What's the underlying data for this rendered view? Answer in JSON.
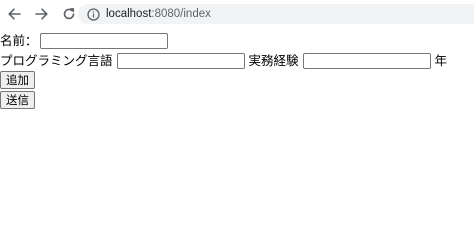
{
  "browser": {
    "url_host": "localhost",
    "url_rest": ":8080/index",
    "back_icon": "back-arrow-icon",
    "forward_icon": "forward-arrow-icon",
    "reload_icon": "reload-icon",
    "info_icon": "info-icon"
  },
  "form": {
    "name_label": "名前：",
    "name_value": "",
    "lang_label": "プログラミング言語",
    "lang_value": "",
    "exp_label": "実務経験",
    "exp_value": "",
    "years_label": "年",
    "add_button": "追加",
    "submit_button": "送信"
  },
  "colors": {
    "omnibox_bg": "#f1f3f4",
    "button_bg": "#efefef",
    "input_border": "#767676"
  }
}
